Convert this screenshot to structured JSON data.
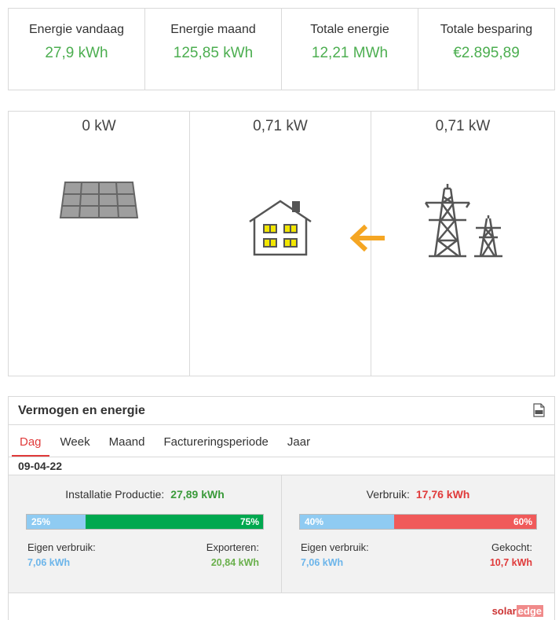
{
  "stats": [
    {
      "label": "Energie vandaag",
      "value": "27,9 kWh"
    },
    {
      "label": "Energie maand",
      "value": "125,85 kWh"
    },
    {
      "label": "Totale energie",
      "value": "12,21 MWh"
    },
    {
      "label": "Totale besparing",
      "value": "€2.895,89"
    }
  ],
  "flow": {
    "solar_kw": "0 kW",
    "home_kw": "0,71 kW",
    "grid_kw": "0,71 kW",
    "icons": [
      "solar-panel-icon",
      "house-icon",
      "arrow-left-icon",
      "power-pylon-icon"
    ],
    "arrow_color": "#f5a623"
  },
  "panel": {
    "title": "Vermogen en energie",
    "tabs": [
      "Dag",
      "Week",
      "Maand",
      "Factureringsperiode",
      "Jaar"
    ],
    "active_tab": "Dag",
    "date": "09-04-22",
    "production": {
      "label": "Installatie Productie:",
      "value": "27,89 kWh",
      "bar": {
        "left_pct": 25,
        "left_label": "25%",
        "right_label": "75%"
      },
      "left_label": "Eigen verbruik:",
      "left_value": "7,06 kWh",
      "right_label": "Exporteren:",
      "right_value": "20,84 kWh"
    },
    "consumption": {
      "label": "Verbruik:",
      "value": "17,76 kWh",
      "bar": {
        "left_pct": 40,
        "left_label": "40%",
        "right_label": "60%"
      },
      "left_label": "Eigen verbruik:",
      "left_value": "7,06 kWh",
      "right_label": "Gekocht:",
      "right_value": "10,7 kWh"
    },
    "colors": {
      "blue": "#8fcbf2",
      "green": "#00a84f",
      "red": "#f05a5a",
      "green_text": "#4cae50",
      "blue_text": "#6cb5ea",
      "red_text": "#e03a3a",
      "light_green_text": "#6ab04c"
    }
  },
  "logo": {
    "part1": "solar",
    "part2": "edge"
  }
}
